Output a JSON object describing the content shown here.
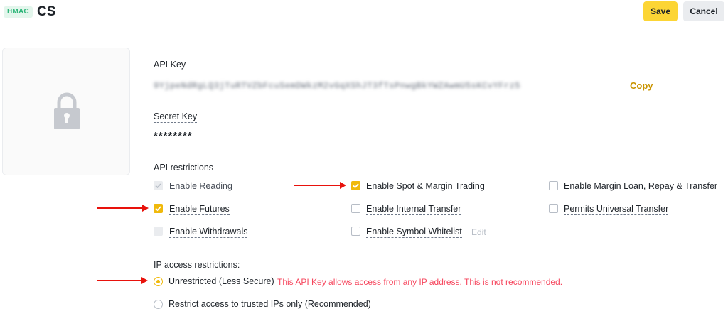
{
  "header": {
    "badge": "HMAC",
    "title": "CS",
    "save_label": "Save",
    "cancel_label": "Cancel"
  },
  "api_key": {
    "label": "API Key",
    "value": "9YjpeNdRgLQ3jTuRTVZbFcuSemDWkzM2vGqXShJT3fTsPnwgBkYWZAwmU5sKCvYFrz5",
    "copy_label": "Copy"
  },
  "secret_key": {
    "label": "Secret Key",
    "value": "********"
  },
  "restrictions": {
    "label": "API restrictions",
    "items": [
      {
        "label": "Enable Reading",
        "state": "disabled-checked"
      },
      {
        "label": "Enable Spot & Margin Trading",
        "state": "checked"
      },
      {
        "label": "Enable Margin Loan, Repay & Transfer",
        "state": "unchecked"
      },
      {
        "label": "Enable Futures",
        "state": "checked"
      },
      {
        "label": "Enable Internal Transfer",
        "state": "unchecked"
      },
      {
        "label": "Permits Universal Transfer",
        "state": "unchecked"
      },
      {
        "label": "Enable Withdrawals",
        "state": "disabled"
      },
      {
        "label": "Enable Symbol Whitelist",
        "state": "unchecked"
      }
    ],
    "edit_label": "Edit"
  },
  "ip": {
    "label": "IP access restrictions:",
    "options": [
      {
        "label": "Unrestricted (Less Secure)",
        "selected": true
      },
      {
        "label": "Restrict access to trusted IPs only (Recommended)",
        "selected": false
      }
    ],
    "warning": "This API Key allows access from any IP address. This is not recommended."
  },
  "colors": {
    "accent": "#f0b90b",
    "save_button": "#fcd535",
    "warning": "#f6465d",
    "annotation_arrow": "#e8120c",
    "badge": "#2fb67a"
  },
  "icons": {
    "lock": "lock-icon",
    "check": "check-icon",
    "arrow": "arrow-right-icon"
  }
}
